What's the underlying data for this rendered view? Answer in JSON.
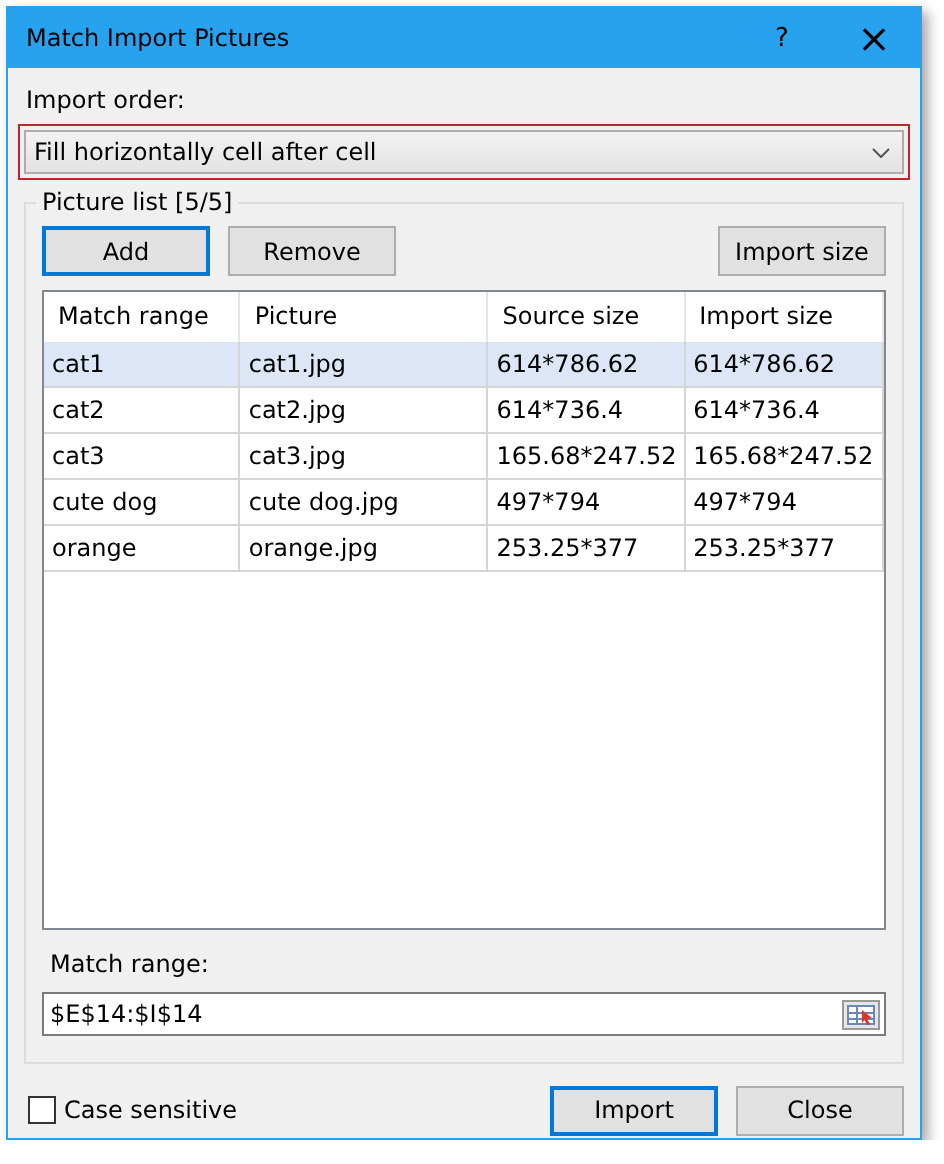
{
  "window": {
    "title": "Match Import Pictures",
    "help": "?",
    "close": "×"
  },
  "import_order": {
    "label": "Import order:",
    "value": "Fill horizontally cell after cell",
    "highlighted": true
  },
  "picture_list": {
    "title": "Picture list [5/5]",
    "buttons": [
      {
        "label": "Add",
        "focused": true
      },
      {
        "label": "Remove",
        "focused": false
      },
      {
        "label": "Import size",
        "focused": false
      }
    ],
    "table": {
      "columns": [
        "Match range",
        "Picture",
        "Source size",
        "Import size"
      ],
      "rows": [
        {
          "cells": [
            "cat1",
            "cat1.jpg",
            "614*786.62",
            "614*786.62"
          ],
          "selected": true
        },
        {
          "cells": [
            "cat2",
            "cat2.jpg",
            "614*736.4",
            "614*736.4"
          ],
          "selected": false
        },
        {
          "cells": [
            "cat3",
            "cat3.jpg",
            "165.68*247.52",
            "165.68*247.52"
          ],
          "selected": false
        },
        {
          "cells": [
            "cute dog",
            "cute dog.jpg",
            "497*794",
            "497*794"
          ],
          "selected": false
        },
        {
          "cells": [
            "orange",
            "orange.jpg",
            "253.25*377",
            "253.25*377"
          ],
          "selected": false
        }
      ]
    },
    "match_range": {
      "label": "Match range:",
      "value": "$E$14:$I$14"
    }
  },
  "case_sensitive": {
    "label": "Case sensitive",
    "checked": false
  },
  "footer_buttons": [
    {
      "label": "Import",
      "focused": true
    },
    {
      "label": "Close",
      "focused": false
    }
  ]
}
